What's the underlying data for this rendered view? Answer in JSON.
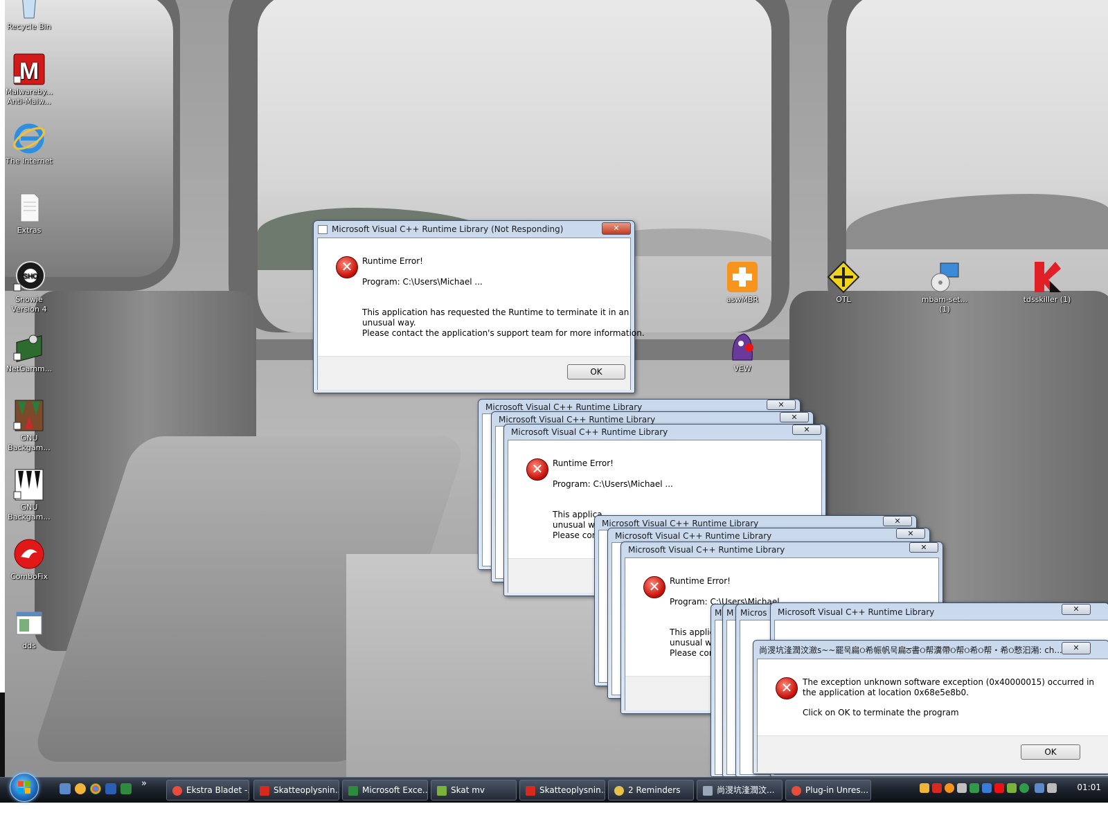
{
  "desktop_icons": [
    {
      "label": "Recycle Bin",
      "icon": "recycle-bin-icon"
    },
    {
      "label": "Malwareby... Anti-Malw...",
      "icon": "malwarebytes-icon"
    },
    {
      "label": "The Internet",
      "icon": "internet-explorer-icon"
    },
    {
      "label": "Extras",
      "icon": "document-icon"
    },
    {
      "label": "Snowie Version 4",
      "icon": "snowie-icon"
    },
    {
      "label": "NetGamm...",
      "icon": "netgammon-icon"
    },
    {
      "label": "GNU Backgam...",
      "icon": "gnu-backgammon-icon"
    },
    {
      "label": "GNU Backgam...",
      "icon": "gnu-backgammon-icon"
    },
    {
      "label": "ComboFix",
      "icon": "combofix-icon"
    },
    {
      "label": "dds",
      "icon": "dds-icon"
    },
    {
      "label": "aswMBR",
      "icon": "aswmbr-icon"
    },
    {
      "label": "OTL",
      "icon": "otl-icon"
    },
    {
      "label": "mbam-set... (1)",
      "icon": "installer-icon"
    },
    {
      "label": "tdsskiller (1)",
      "icon": "kaspersky-icon"
    },
    {
      "label": "VEW",
      "icon": "vew-icon"
    }
  ],
  "dialog_main": {
    "title": "Microsoft Visual C++ Runtime Library (Not Responding)",
    "heading": "Runtime Error!",
    "program": "Program: C:\\Users\\Michael ...",
    "body_line1": "This application has requested the Runtime to terminate it in an",
    "body_line2": "unusual way.",
    "body_line3": "Please contact the application's support team for more information.",
    "ok_label": "OK",
    "close_label": "✕"
  },
  "stack_title": "Microsoft Visual C++ Runtime Library",
  "stack_heading": "Runtime Error!",
  "stack_program": "Program: C:\\Users\\Michael ...",
  "stack_program_short": "Program: C:\\Users\\Michael",
  "stack_body_a": "This applica",
  "stack_body_b": "unusual wa",
  "stack_body_c": "Please cont",
  "stack_body_a2": "This applica",
  "stack_body_b2": "unusual wa",
  "stack_body_c2": "Please cont",
  "stack_close": "✕",
  "tiny_title_1": "M",
  "tiny_title_2": "M",
  "tiny_title_3": "Micros",
  "dialog_exception": {
    "title": "尚渂坑湰潤汶瀲s~~罷묵扁ଠ希帪帆묵扁ਠ書ଠ帮瀵帶ଠ帮ଠ希ଠ帮・希ଠ慗汩潲: ch...",
    "line1": "The exception unknown software exception (0x40000015) occurred in",
    "line2": "the application at location 0x68e5e8b0.",
    "line3": "Click on OK to terminate the program",
    "ok_label": "OK",
    "close_label": "✕"
  },
  "taskbar": {
    "chevron": "»",
    "buttons": [
      {
        "label": "Ekstra Bladet -...",
        "color": "#e84c3d"
      },
      {
        "label": "Skatteoplysnin...",
        "color": "#d62a1f"
      },
      {
        "label": "Microsoft Exce...",
        "color": "#2e8b3e"
      },
      {
        "label": "Skat mv",
        "color": "#7bb33a"
      },
      {
        "label": "Skatteoplysnin...",
        "color": "#d62a1f"
      },
      {
        "label": "2 Reminders",
        "color": "#e7c04a"
      },
      {
        "label": "尚渂坑湰潤汶...",
        "color": "#9aa7b8"
      },
      {
        "label": "Plug-in Unres...",
        "color": "#e84c3d"
      }
    ],
    "clock": "01:01"
  }
}
